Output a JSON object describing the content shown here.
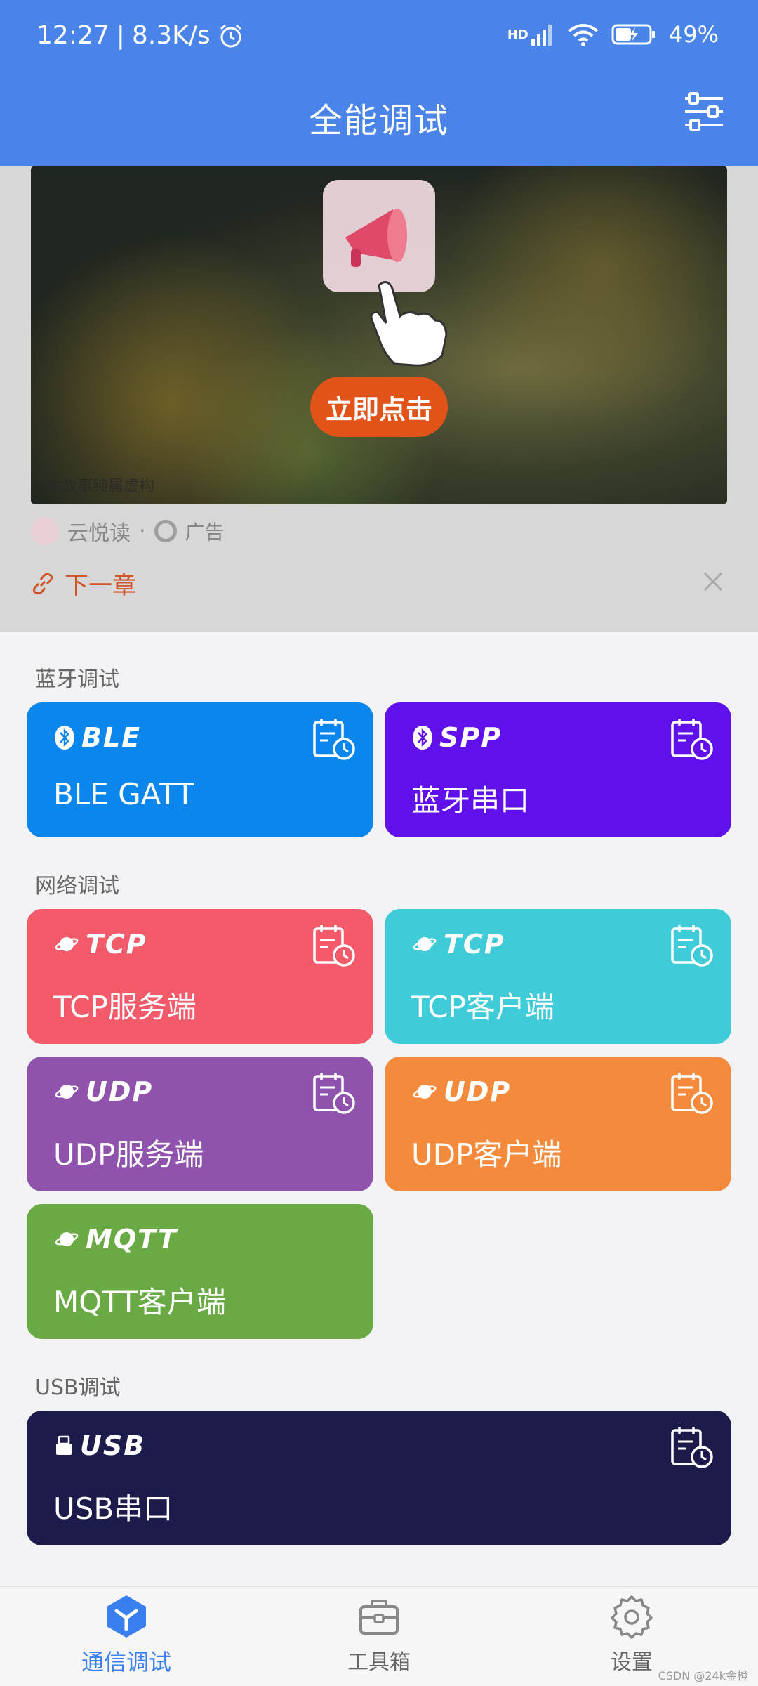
{
  "status": {
    "time": "12:27",
    "speed": "8.3K/s",
    "network": "HD",
    "battery": "49%"
  },
  "app": {
    "title": "全能调试"
  },
  "ad": {
    "cta": "立即点击",
    "disclaimer": "本故事纯属虚构",
    "app_name": "云悦读",
    "dot": "·",
    "ad_label": "广告",
    "next": "下一章"
  },
  "sections": {
    "bluetooth": "蓝牙调试",
    "network": "网络调试",
    "usb": "USB调试"
  },
  "cards": {
    "ble": {
      "tag": "BLE",
      "label": "BLE GATT",
      "color": "#0a86ec"
    },
    "spp": {
      "tag": "SPP",
      "label": "蓝牙串口",
      "color": "#6010ea"
    },
    "tcp_server": {
      "tag": "TCP",
      "label": "TCP服务端",
      "color": "#f35a6a"
    },
    "tcp_client": {
      "tag": "TCP",
      "label": "TCP客户端",
      "color": "#40cbd8"
    },
    "udp_server": {
      "tag": "UDP",
      "label": "UDP服务端",
      "color": "#8f53ad"
    },
    "udp_client": {
      "tag": "UDP",
      "label": "UDP客户端",
      "color": "#f48a3c"
    },
    "mqtt_client": {
      "tag": "MQTT",
      "label": "MQTT客户端",
      "color": "#6aaa45"
    },
    "usb_serial": {
      "tag": "USB",
      "label": "USB串口",
      "color": "#1c1b4b"
    }
  },
  "nav": {
    "comm": "通信调试",
    "tools": "工具箱",
    "settings": "设置",
    "active_color": "#3a7ff0"
  },
  "watermark": "CSDN @24k金橙"
}
